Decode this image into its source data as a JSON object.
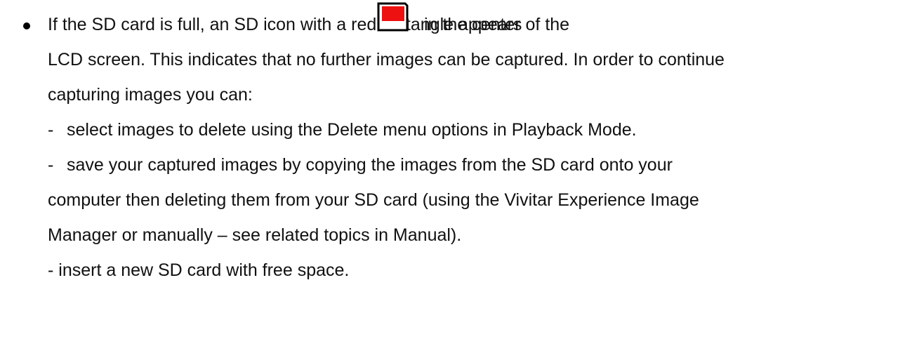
{
  "bullet": {
    "lines": [
      "If the SD card is full, an SD icon with a red rectangle appears",
      "in the center of the",
      "LCD screen. This indicates that no further images can be captured. In order to continue",
      "capturing images you can:"
    ]
  },
  "options": [
    {
      "dash": "-",
      "text": "select images to delete using the Delete menu options in Playback Mode."
    },
    {
      "dash": "-",
      "lines": [
        "save your captured images by copying the images from the SD card onto your",
        "computer then deleting them from your SD card (using the Vivitar Experience Image",
        "Manager or manually – see related topics in Manual)."
      ]
    },
    {
      "text": "- insert a new SD card with free space."
    }
  ],
  "icon": {
    "name": "sd-card-full-icon",
    "fill": "#ee1111",
    "stroke": "#000000"
  }
}
